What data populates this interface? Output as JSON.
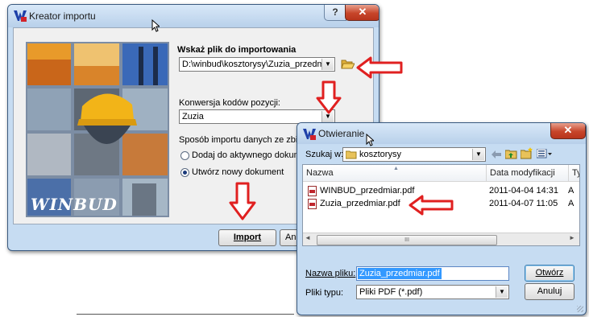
{
  "import_wizard": {
    "title": "Kreator importu",
    "help_glyph": "?",
    "close_glyph": "✕",
    "banner_logo": "WINBUD",
    "file_section_label": "Wskaż plik do importowania",
    "file_path": "D:\\winbud\\kosztorysy\\Zuzia_przedmiar.pdf",
    "conversion_label": "Konwersja kodów pozycji:",
    "conversion_value": "Zuzia",
    "mode_label": "Sposób importu danych ze zbioru:",
    "mode_options": [
      {
        "label": "Dodaj do aktywnego dokumentu",
        "selected": false
      },
      {
        "label": "Utwórz nowy dokument",
        "selected": true
      }
    ],
    "import_button": "Import",
    "cancel_button_partial": "Anu"
  },
  "open_dialog": {
    "title": "Otwieranie",
    "close_glyph": "✕",
    "look_in_label": "Szukaj w:",
    "look_in_value": "kosztorysy",
    "columns": [
      "Nazwa",
      "Data modyfikacji",
      "Ty"
    ],
    "files": [
      {
        "name": "WINBUD_przedmiar.pdf",
        "date": "2011-04-04 14:31",
        "type": "A"
      },
      {
        "name": "Zuzia_przedmiar.pdf",
        "date": "2011-04-07 11:05",
        "type": "A"
      }
    ],
    "scroll_glyph": "III",
    "filename_label": "Nazwa pliku:",
    "filename_value": "Zuzia_przedmiar.pdf",
    "filetype_label": "Pliki typu:",
    "filetype_value": "Pliki PDF (*.pdf)",
    "open_button": "Otwórz",
    "cancel_button": "Anuluj"
  },
  "colors": {
    "arrow_red": "#e02020",
    "title_bar": "#b8d0ea",
    "close_red": "#c7452a",
    "banner_yellow": "#f2b418"
  },
  "icons": [
    "app-logo-icon",
    "folder-open-icon",
    "folder-icon",
    "back-arrow-icon",
    "up-folder-icon",
    "new-folder-icon",
    "view-menu-icon",
    "pdf-file-icon",
    "mouse-cursor-icon",
    "red-arrow-annotation"
  ]
}
